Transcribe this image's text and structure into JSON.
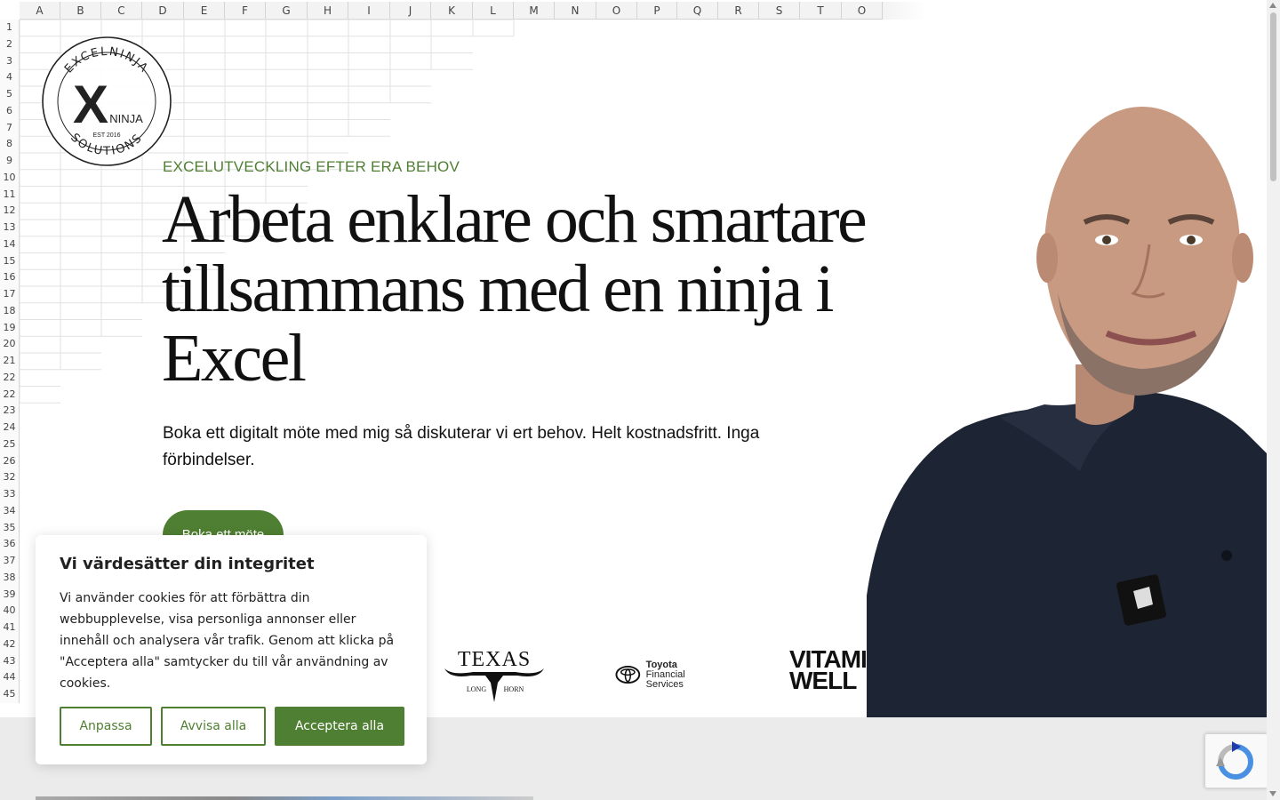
{
  "spreadsheet": {
    "columns": [
      "A",
      "B",
      "C",
      "D",
      "E",
      "F",
      "G",
      "H",
      "I",
      "J",
      "K",
      "L",
      "M",
      "N",
      "O",
      "P",
      "Q",
      "R",
      "S",
      "T",
      "O"
    ],
    "rows": [
      "1",
      "2",
      "3",
      "4",
      "5",
      "6",
      "7",
      "8",
      "9",
      "10",
      "11",
      "12",
      "13",
      "14",
      "15",
      "16",
      "17",
      "18",
      "19",
      "20",
      "21",
      "22",
      "22",
      "23",
      "24",
      "25",
      "26",
      "32",
      "33",
      "34",
      "35",
      "36",
      "37",
      "38",
      "39",
      "40",
      "41",
      "42",
      "43",
      "44",
      "45"
    ]
  },
  "logo": {
    "top_text": "EXCELNINJA",
    "bottom_text": "SOLUTIONS",
    "mark": "X",
    "mark_sub": "NINJA",
    "est": "EST 2016"
  },
  "hero": {
    "eyebrow": "EXCELUTVECKLING EFTER ERA BEHOV",
    "headline": "Arbeta enklare och smartare tillsammans med en ninja i Excel",
    "lead": "Boka ett digitalt möte med mig så diskuterar vi ert behov. Helt kostnadsfritt. Inga förbindelser.",
    "cta": "Boka ett möte"
  },
  "clients": {
    "texas": {
      "name": "TEXAS",
      "sub_left": "LONG",
      "sub_right": "HORN"
    },
    "toyota": {
      "line1": "Toyota",
      "line2": "Financial Services"
    },
    "vitamin": {
      "line1": "VITAMI",
      "line2": "WELL"
    }
  },
  "cookie": {
    "title": "Vi värdesätter din integritet",
    "body": "Vi använder cookies för att förbättra din webbupplevelse, visa personliga annonser eller innehåll och analysera vår trafik. Genom att klicka på \"Acceptera alla\" samtycker du till vår användning av cookies.",
    "customize": "Anpassa",
    "reject": "Avvisa alla",
    "accept": "Acceptera alla"
  },
  "colors": {
    "brand_green": "#4f7f32",
    "text": "#111111",
    "section_gray": "#ebebeb"
  }
}
